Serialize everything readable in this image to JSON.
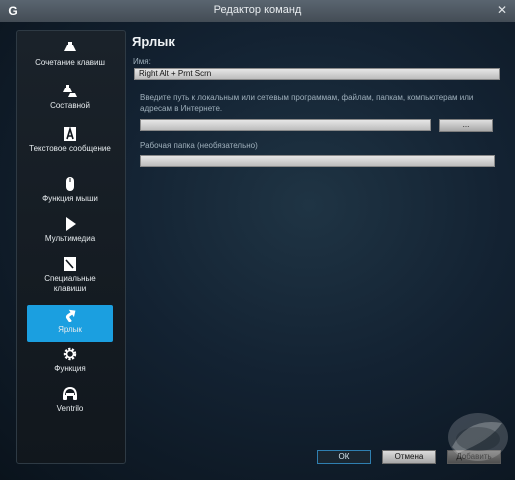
{
  "window": {
    "title": "Редактор команд",
    "close_glyph": "✕",
    "app_logo": "G"
  },
  "sidebar": {
    "items": [
      {
        "label": "Сочетание клавиш",
        "icon": "keystroke-icon"
      },
      {
        "label": "Составной",
        "icon": "multikey-icon"
      },
      {
        "label": "Текстовое сообщение",
        "icon": "text-block-icon"
      },
      {
        "label": "Функция мыши",
        "icon": "mouse-icon"
      },
      {
        "label": "Мультимедиа",
        "icon": "play-icon"
      },
      {
        "label": "Специальные клавиши",
        "icon": "hotkey-icon"
      },
      {
        "label": "Ярлык",
        "icon": "shortcut-arrow-icon",
        "active": true
      },
      {
        "label": "Функция",
        "icon": "gear-icon"
      },
      {
        "label": "Ventrilo",
        "icon": "headset-icon"
      }
    ]
  },
  "main": {
    "section_title": "Ярлык",
    "name_label": "Имя:",
    "name_value": "Right Alt + Prnt Scrn",
    "path_description": "Введите путь к локальным или сетевым программам, файлам, папкам, компьютерам или адресам в Интернете.",
    "path_value": "",
    "browse_label": "...",
    "workdir_label": "Рабочая папка (необязательно)",
    "workdir_value": ""
  },
  "footer": {
    "ok": "ОК",
    "cancel": "Отмена",
    "add": "Добавить"
  },
  "colors": {
    "accent": "#1b9fe0",
    "bg": "#132232"
  }
}
